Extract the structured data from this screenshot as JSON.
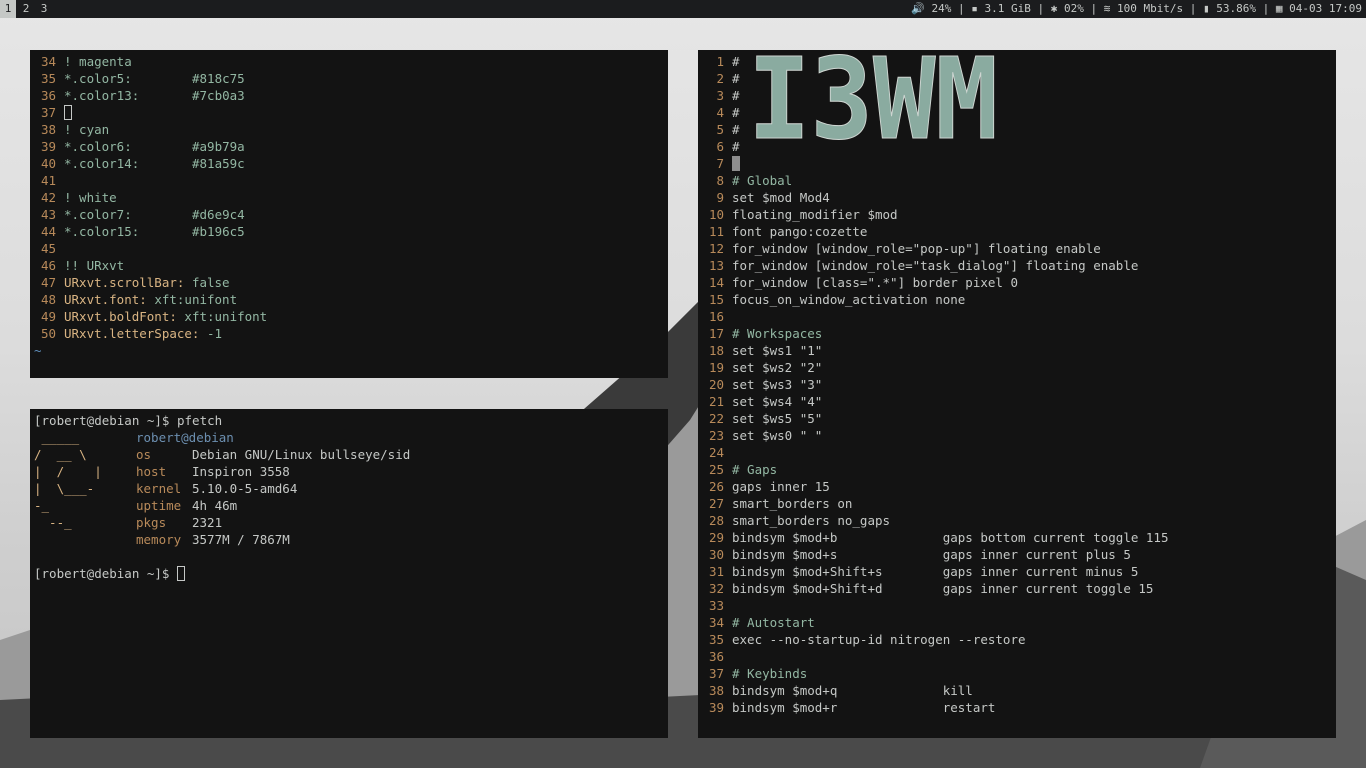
{
  "bar": {
    "workspaces": [
      {
        "label": "1",
        "active": true
      },
      {
        "label": "2",
        "active": false
      },
      {
        "label": "3",
        "active": false
      }
    ],
    "status": "🔊 24% | ▪ 3.1 GiB | ✱ 02% | ≋ 100 Mbit/s | ▮ 53.86% | ▦ 04-03 17:09"
  },
  "xres": {
    "lines": [
      {
        "n": "34",
        "t": "! magenta",
        "k": "comment"
      },
      {
        "n": "35",
        "t": "*.color5:",
        "v": "#818c75",
        "k": "color"
      },
      {
        "n": "36",
        "t": "*.color13:",
        "v": "#7cb0a3",
        "k": "color"
      },
      {
        "n": "37",
        "t": "",
        "k": "cursor"
      },
      {
        "n": "38",
        "t": "! cyan",
        "k": "comment"
      },
      {
        "n": "39",
        "t": "*.color6:",
        "v": "#a9b79a",
        "k": "color"
      },
      {
        "n": "40",
        "t": "*.color14:",
        "v": "#81a59c",
        "k": "color"
      },
      {
        "n": "41",
        "t": "",
        "k": "blank"
      },
      {
        "n": "42",
        "t": "! white",
        "k": "comment"
      },
      {
        "n": "43",
        "t": "*.color7:",
        "v": "#d6e9c4",
        "k": "color"
      },
      {
        "n": "44",
        "t": "*.color15:",
        "v": "#b196c5",
        "k": "color"
      },
      {
        "n": "45",
        "t": "",
        "k": "blank"
      },
      {
        "n": "46",
        "t": "!! URxvt",
        "k": "comment"
      },
      {
        "n": "47",
        "t": "URxvt.scrollBar:",
        "v": " false",
        "k": "prop"
      },
      {
        "n": "48",
        "t": "URxvt.font:",
        "v": " xft:unifont",
        "k": "prop"
      },
      {
        "n": "49",
        "t": "URxvt.boldFont:",
        "v": " xft:unifont",
        "k": "prop"
      },
      {
        "n": "50",
        "t": "URxvt.letterSpace:",
        "v": " -1",
        "k": "prop"
      }
    ],
    "tilde": "~"
  },
  "term": {
    "prompt1": "[robert@debian ~]$ pfetch",
    "logo": [
      " _____",
      "/  __ \\",
      "|  /    |",
      "|  \\___-",
      "-_",
      "  --_"
    ],
    "info": [
      {
        "key": "",
        "val": "robert@debian",
        "user": true
      },
      {
        "key": "os",
        "val": "Debian GNU/Linux bullseye/sid"
      },
      {
        "key": "host",
        "val": "Inspiron 3558"
      },
      {
        "key": "kernel",
        "val": "5.10.0-5-amd64"
      },
      {
        "key": "uptime",
        "val": "4h 46m"
      },
      {
        "key": "pkgs",
        "val": "2321"
      },
      {
        "key": "memory",
        "val": "3577M / 7867M"
      }
    ],
    "prompt2": "[robert@debian ~]$ "
  },
  "i3": {
    "logo_text": "I3WM",
    "lines": [
      {
        "n": "1",
        "t": "#"
      },
      {
        "n": "2",
        "t": "#"
      },
      {
        "n": "3",
        "t": "#"
      },
      {
        "n": "4",
        "t": "#"
      },
      {
        "n": "5",
        "t": "#"
      },
      {
        "n": "6",
        "t": "#"
      },
      {
        "n": "7",
        "t": "",
        "cursor": true
      },
      {
        "n": "8",
        "t": "# Global",
        "c": true
      },
      {
        "n": "9",
        "t": "set $mod Mod4"
      },
      {
        "n": "10",
        "t": "floating_modifier $mod"
      },
      {
        "n": "11",
        "t": "font pango:cozette"
      },
      {
        "n": "12",
        "t": "for_window [window_role=\"pop-up\"] floating enable"
      },
      {
        "n": "13",
        "t": "for_window [window_role=\"task_dialog\"] floating enable"
      },
      {
        "n": "14",
        "t": "for_window [class=\".*\"] border pixel 0"
      },
      {
        "n": "15",
        "t": "focus_on_window_activation none"
      },
      {
        "n": "16",
        "t": ""
      },
      {
        "n": "17",
        "t": "# Workspaces",
        "c": true
      },
      {
        "n": "18",
        "t": "set $ws1 \"1\""
      },
      {
        "n": "19",
        "t": "set $ws2 \"2\""
      },
      {
        "n": "20",
        "t": "set $ws3 \"3\""
      },
      {
        "n": "21",
        "t": "set $ws4 \"4\""
      },
      {
        "n": "22",
        "t": "set $ws5 \"5\""
      },
      {
        "n": "23",
        "t": "set $ws0 \" \""
      },
      {
        "n": "24",
        "t": ""
      },
      {
        "n": "25",
        "t": "# Gaps",
        "c": true
      },
      {
        "n": "26",
        "t": "gaps inner 15"
      },
      {
        "n": "27",
        "t": "smart_borders on"
      },
      {
        "n": "28",
        "t": "smart_borders no_gaps"
      },
      {
        "n": "29",
        "t": "bindsym $mod+b              gaps bottom current toggle 115"
      },
      {
        "n": "30",
        "t": "bindsym $mod+s              gaps inner current plus 5"
      },
      {
        "n": "31",
        "t": "bindsym $mod+Shift+s        gaps inner current minus 5"
      },
      {
        "n": "32",
        "t": "bindsym $mod+Shift+d        gaps inner current toggle 15"
      },
      {
        "n": "33",
        "t": ""
      },
      {
        "n": "34",
        "t": "# Autostart",
        "c": true
      },
      {
        "n": "35",
        "t": "exec --no-startup-id nitrogen --restore"
      },
      {
        "n": "36",
        "t": ""
      },
      {
        "n": "37",
        "t": "# Keybinds",
        "c": true
      },
      {
        "n": "38",
        "t": "bindsym $mod+q              kill"
      },
      {
        "n": "39",
        "t": "bindsym $mod+r              restart"
      }
    ]
  }
}
